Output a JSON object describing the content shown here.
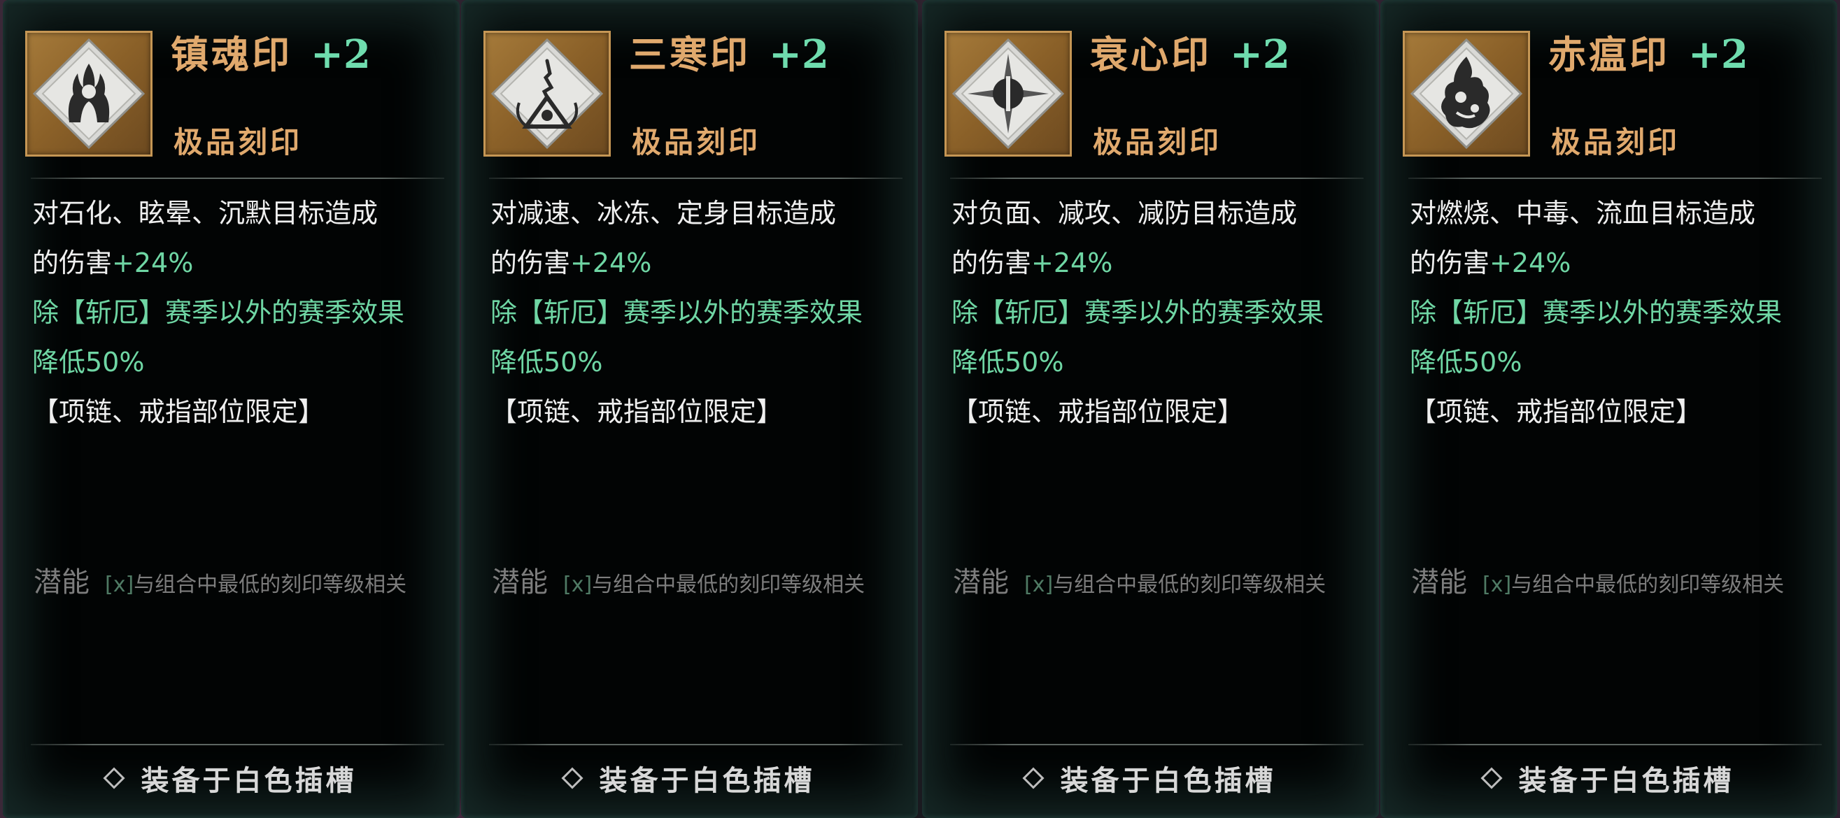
{
  "cards": [
    {
      "title": "镇魂印",
      "plus": "+2",
      "grade": "极品刻印",
      "icon": "flaming-spirit-rune-icon",
      "line1": "对石化、眩晕、沉默目标造成",
      "line2_white": "的伤害",
      "line2_green": "+24%",
      "line3": "除【斩厄】赛季以外的赛季效果",
      "line4": "降低50%",
      "line5": "【项链、戒指部位限定】",
      "potential_label": "潜能",
      "potential_x": "[x]",
      "potential_text": "与组合中最低的刻印等级相关",
      "equip": "装备于白色插槽"
    },
    {
      "title": "三寒印",
      "plus": "+2",
      "grade": "极品刻印",
      "icon": "frost-triangle-rune-icon",
      "line1": "对减速、冰冻、定身目标造成",
      "line2_white": "的伤害",
      "line2_green": "+24%",
      "line3": "除【斩厄】赛季以外的赛季效果",
      "line4": "降低50%",
      "line5": "【项链、戒指部位限定】",
      "potential_label": "潜能",
      "potential_x": "[x]",
      "potential_text": "与组合中最低的刻印等级相关",
      "equip": "装备于白色插槽"
    },
    {
      "title": "衰心印",
      "plus": "+2",
      "grade": "极品刻印",
      "icon": "piercing-star-rune-icon",
      "line1": "对负面、减攻、减防目标造成",
      "line2_white": "的伤害",
      "line2_green": "+24%",
      "line3": "除【斩厄】赛季以外的赛季效果",
      "line4": "降低50%",
      "line5": "【项链、戒指部位限定】",
      "potential_label": "潜能",
      "potential_x": "[x]",
      "potential_text": "与组合中最低的刻印等级相关",
      "equip": "装备于白色插槽"
    },
    {
      "title": "赤瘟印",
      "plus": "+2",
      "grade": "极品刻印",
      "icon": "plague-flame-rune-icon",
      "line1": "对燃烧、中毒、流血目标造成",
      "line2_white": "的伤害",
      "line2_green": "+24%",
      "line3": "除【斩厄】赛季以外的赛季效果",
      "line4": "降低50%",
      "line5": "【项链、戒指部位限定】",
      "potential_label": "潜能",
      "potential_x": "[x]",
      "potential_text": "与组合中最低的刻印等级相关",
      "equip": "装备于白色插槽"
    }
  ],
  "colors": {
    "title": "#e0a96d",
    "accent_green": "#6fdcae",
    "card_bg": "#020404",
    "frame": "#a57a3a"
  }
}
